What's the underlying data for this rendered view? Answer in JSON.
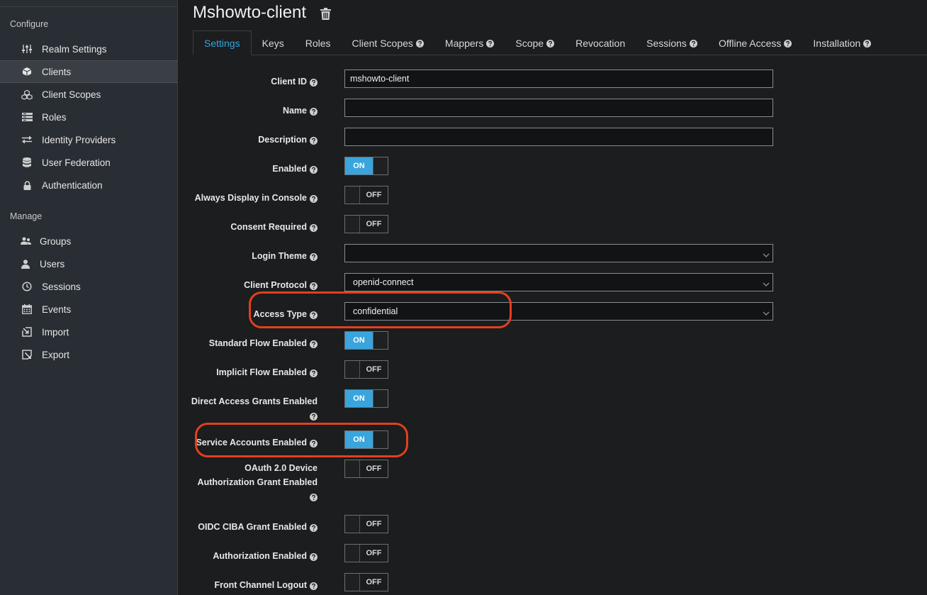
{
  "sidebar": {
    "configure_label": "Configure",
    "manage_label": "Manage",
    "configure_items": [
      {
        "label": "Realm Settings",
        "icon": "sliders-icon"
      },
      {
        "label": "Clients",
        "icon": "cube-icon"
      },
      {
        "label": "Client Scopes",
        "icon": "cubes-icon"
      },
      {
        "label": "Roles",
        "icon": "list-icon"
      },
      {
        "label": "Identity Providers",
        "icon": "exchange-icon"
      },
      {
        "label": "User Federation",
        "icon": "database-icon"
      },
      {
        "label": "Authentication",
        "icon": "lock-icon"
      }
    ],
    "manage_items": [
      {
        "label": "Groups",
        "icon": "users-icon"
      },
      {
        "label": "Users",
        "icon": "user-icon"
      },
      {
        "label": "Sessions",
        "icon": "clock-icon"
      },
      {
        "label": "Events",
        "icon": "calendar-icon"
      },
      {
        "label": "Import",
        "icon": "import-icon"
      },
      {
        "label": "Export",
        "icon": "export-icon"
      }
    ],
    "active_item": "Clients"
  },
  "header": {
    "title": "Mshowto-client",
    "delete_icon": "trash-icon"
  },
  "tabs": [
    {
      "label": "Settings",
      "help": false
    },
    {
      "label": "Keys",
      "help": false
    },
    {
      "label": "Roles",
      "help": false
    },
    {
      "label": "Client Scopes",
      "help": true
    },
    {
      "label": "Mappers",
      "help": true
    },
    {
      "label": "Scope",
      "help": true
    },
    {
      "label": "Revocation",
      "help": false
    },
    {
      "label": "Sessions",
      "help": true
    },
    {
      "label": "Offline Access",
      "help": true
    },
    {
      "label": "Installation",
      "help": true
    }
  ],
  "form": {
    "client_id": {
      "label": "Client ID",
      "value": "mshowto-client"
    },
    "name": {
      "label": "Name",
      "value": ""
    },
    "description": {
      "label": "Description",
      "value": ""
    },
    "enabled": {
      "label": "Enabled",
      "state": "ON"
    },
    "always_display": {
      "label": "Always Display in Console",
      "state": "OFF"
    },
    "consent_required": {
      "label": "Consent Required",
      "state": "OFF"
    },
    "login_theme": {
      "label": "Login Theme",
      "value": ""
    },
    "client_protocol": {
      "label": "Client Protocol",
      "value": "openid-connect"
    },
    "access_type": {
      "label": "Access Type",
      "value": "confidential"
    },
    "standard_flow": {
      "label": "Standard Flow Enabled",
      "state": "ON"
    },
    "implicit_flow": {
      "label": "Implicit Flow Enabled",
      "state": "OFF"
    },
    "direct_access": {
      "label": "Direct Access Grants Enabled",
      "state": "ON"
    },
    "service_accounts": {
      "label": "Service Accounts Enabled",
      "state": "ON"
    },
    "oauth_device": {
      "label_line1": "OAuth 2.0 Device",
      "label_line2": "Authorization Grant Enabled",
      "state": "OFF"
    },
    "oidc_ciba": {
      "label": "OIDC CIBA Grant Enabled",
      "state": "OFF"
    },
    "authorization": {
      "label": "Authorization Enabled",
      "state": "OFF"
    },
    "front_channel": {
      "label": "Front Channel Logout",
      "state": "OFF"
    }
  },
  "colors": {
    "accent": "#39a5dc",
    "highlight": "#e2401e"
  }
}
